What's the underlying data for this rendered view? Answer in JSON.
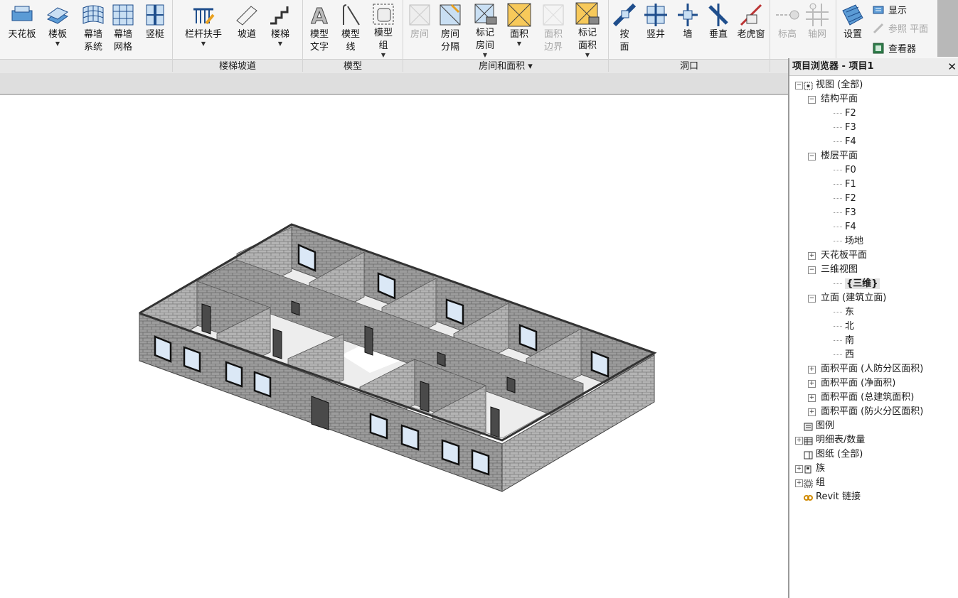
{
  "ribbon": {
    "buttons": [
      {
        "label": "天花板",
        "icon": "ceiling-icon",
        "has_menu": false,
        "disabled": false
      },
      {
        "label": "楼板",
        "icon": "floor-icon",
        "has_menu": true,
        "disabled": false
      },
      {
        "label": "幕墙\n系统",
        "icon": "curtain-system-icon",
        "has_menu": false,
        "disabled": false
      },
      {
        "label": "幕墙\n网格",
        "icon": "curtain-grid-icon",
        "has_menu": false,
        "disabled": false
      },
      {
        "label": "竖梃",
        "icon": "mullion-icon",
        "has_menu": false,
        "disabled": false
      },
      {
        "label": "栏杆扶手",
        "icon": "railing-icon",
        "has_menu": true,
        "disabled": false
      },
      {
        "label": "坡道",
        "icon": "ramp-icon",
        "has_menu": false,
        "disabled": false
      },
      {
        "label": "楼梯",
        "icon": "stair-icon",
        "has_menu": true,
        "disabled": false
      },
      {
        "label": "模型\n文字",
        "icon": "model-text-icon",
        "has_menu": false,
        "disabled": false
      },
      {
        "label": "模型\n线",
        "icon": "model-line-icon",
        "has_menu": false,
        "disabled": false
      },
      {
        "label": "模型\n组",
        "icon": "model-group-icon",
        "has_menu": true,
        "disabled": false
      },
      {
        "label": "房间",
        "icon": "room-icon",
        "has_menu": false,
        "disabled": true
      },
      {
        "label": "房间\n分隔",
        "icon": "room-separator-icon",
        "has_menu": false,
        "disabled": false
      },
      {
        "label": "标记\n房间",
        "icon": "tag-room-icon",
        "has_menu": true,
        "disabled": false
      },
      {
        "label": "面积",
        "icon": "area-icon",
        "has_menu": true,
        "disabled": false
      },
      {
        "label": "面积\n边界",
        "icon": "area-boundary-icon",
        "has_menu": false,
        "disabled": true
      },
      {
        "label": "标记\n面积",
        "icon": "tag-area-icon",
        "has_menu": true,
        "disabled": false
      },
      {
        "label": "按\n面",
        "icon": "by-face-icon",
        "has_menu": false,
        "disabled": false
      },
      {
        "label": "竖井",
        "icon": "shaft-icon",
        "has_menu": false,
        "disabled": false
      },
      {
        "label": "墙",
        "icon": "wall-opening-icon",
        "has_menu": false,
        "disabled": false
      },
      {
        "label": "垂直",
        "icon": "vertical-opening-icon",
        "has_menu": false,
        "disabled": false
      },
      {
        "label": "老虎窗",
        "icon": "dormer-icon",
        "has_menu": false,
        "disabled": false
      },
      {
        "label": "标高",
        "icon": "level-icon",
        "has_menu": false,
        "disabled": true
      },
      {
        "label": "轴网",
        "icon": "grid-icon",
        "has_menu": false,
        "disabled": true
      },
      {
        "label": "设置",
        "icon": "workplane-set-icon",
        "has_menu": false,
        "disabled": false
      }
    ],
    "small_buttons": [
      {
        "label": "显示",
        "icon": "show-workplane-icon",
        "disabled": false
      },
      {
        "label": "参照 平面",
        "icon": "ref-plane-icon",
        "disabled": true
      },
      {
        "label": "查看器",
        "icon": "viewer-icon",
        "disabled": false
      }
    ],
    "panels": [
      {
        "label": "楼梯坡道"
      },
      {
        "label": "模型"
      },
      {
        "label": "房间和面积 ▾"
      },
      {
        "label": "洞口"
      }
    ]
  },
  "browser": {
    "title": "项目浏览器 - 项目1",
    "close": "✕",
    "items": [
      {
        "label": "视图 (全部)",
        "level": 0,
        "toggle": "−",
        "icon": "views-icon"
      },
      {
        "label": "结构平面",
        "level": 1,
        "toggle": "−"
      },
      {
        "label": "F2",
        "level": 2
      },
      {
        "label": "F3",
        "level": 2
      },
      {
        "label": "F4",
        "level": 2
      },
      {
        "label": "楼层平面",
        "level": 1,
        "toggle": "−"
      },
      {
        "label": "F0",
        "level": 2
      },
      {
        "label": "F1",
        "level": 2
      },
      {
        "label": "F2",
        "level": 2
      },
      {
        "label": "F3",
        "level": 2
      },
      {
        "label": "F4",
        "level": 2
      },
      {
        "label": "场地",
        "level": 2
      },
      {
        "label": "天花板平面",
        "level": 1,
        "toggle": "+"
      },
      {
        "label": "三维视图",
        "level": 1,
        "toggle": "−"
      },
      {
        "label": "{三维}",
        "level": 2,
        "selected": true
      },
      {
        "label": "立面 (建筑立面)",
        "level": 1,
        "toggle": "−"
      },
      {
        "label": "东",
        "level": 2
      },
      {
        "label": "北",
        "level": 2
      },
      {
        "label": "南",
        "level": 2
      },
      {
        "label": "西",
        "level": 2
      },
      {
        "label": "面积平面 (人防分区面积)",
        "level": 1,
        "toggle": "+"
      },
      {
        "label": "面积平面 (净面积)",
        "level": 1,
        "toggle": "+"
      },
      {
        "label": "面积平面 (总建筑面积)",
        "level": 1,
        "toggle": "+"
      },
      {
        "label": "面积平面 (防火分区面积)",
        "level": 1,
        "toggle": "+"
      },
      {
        "label": "图例",
        "level": 0,
        "icon": "legend-icon"
      },
      {
        "label": "明细表/数量",
        "level": 0,
        "toggle": "+",
        "icon": "schedule-icon"
      },
      {
        "label": "图纸 (全部)",
        "level": 0,
        "icon": "sheet-icon"
      },
      {
        "label": "族",
        "level": 0,
        "toggle": "+",
        "icon": "family-icon"
      },
      {
        "label": "组",
        "level": 0,
        "toggle": "+",
        "icon": "group-icon"
      },
      {
        "label": "Revit 链接",
        "level": 0,
        "icon": "revit-link-icon"
      }
    ]
  },
  "viewport": {
    "view_name": "{三维}",
    "model_icon": "3d-building-model"
  },
  "colors": {
    "accent": "#1f5fa8",
    "wall_top": "#d4d4d4",
    "wall_side": "#9a9a9a",
    "window": "#dbe8f6"
  }
}
